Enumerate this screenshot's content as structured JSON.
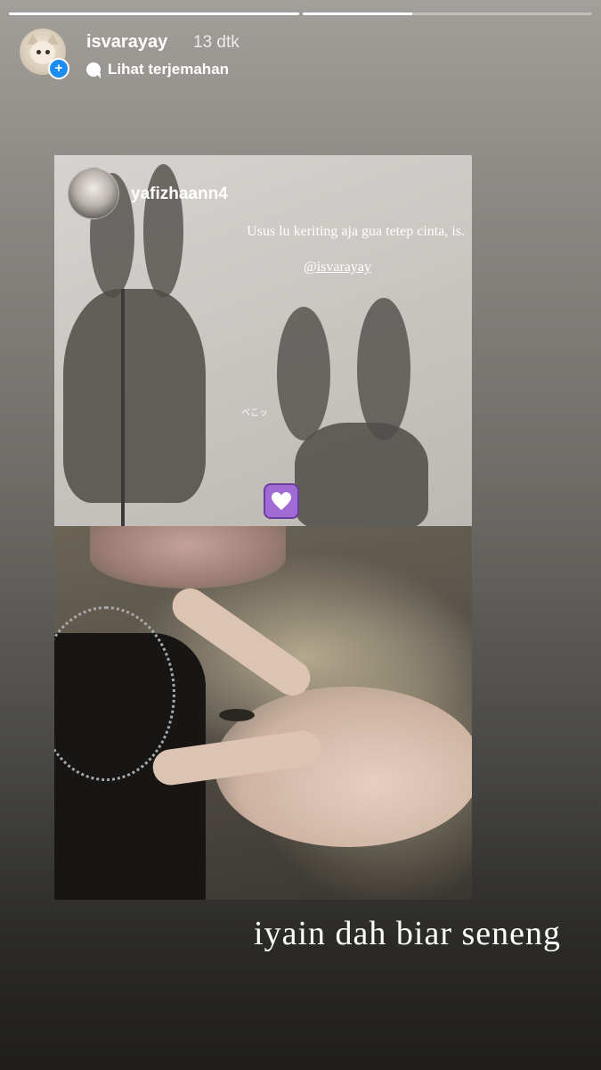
{
  "story_progress": [
    {
      "fill_fraction": 1.0
    },
    {
      "fill_fraction": 0.38
    }
  ],
  "header": {
    "username": "isvarayay",
    "time": "13 dtk",
    "translate_label": "Lihat terjemahan",
    "add_badge": "+"
  },
  "repost": {
    "username": "yafizhaann4",
    "quote": "Usus lu keriting aja gua tetep cinta, is.",
    "mention": "@isvarayay",
    "image_text": "べこッ"
  },
  "caption": "iyain dah biar seneng",
  "colors": {
    "heart_bg": "#a16bd6",
    "badge": "#1d8cf0"
  }
}
